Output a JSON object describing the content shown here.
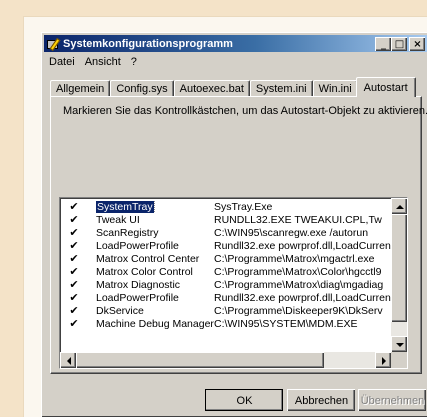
{
  "window": {
    "title": "Systemkonfigurationsprogramm",
    "buttons": {
      "minimize": "_",
      "maximize": "□",
      "close": "×"
    }
  },
  "menu": [
    {
      "label": "Datei"
    },
    {
      "label": "Ansicht"
    },
    {
      "label": "?"
    }
  ],
  "tabs": [
    {
      "label": "Allgemein"
    },
    {
      "label": "Config.sys"
    },
    {
      "label": "Autoexec.bat"
    },
    {
      "label": "System.ini"
    },
    {
      "label": "Win.ini"
    },
    {
      "label": "Autostart",
      "active": true
    }
  ],
  "panel": {
    "instruction": "Markieren Sie das Kontrollkästchen, um das Autostart-Objekt zu aktivieren."
  },
  "startup_items": [
    {
      "checked": true,
      "name": "SystemTray",
      "command": "SysTray.Exe",
      "selected": true
    },
    {
      "checked": true,
      "name": "Tweak UI",
      "command": "RUNDLL32.EXE TWEAKUI.CPL,Tw"
    },
    {
      "checked": true,
      "name": "ScanRegistry",
      "command": "C:\\WIN95\\scanregw.exe /autorun"
    },
    {
      "checked": true,
      "name": "LoadPowerProfile",
      "command": "Rundll32.exe powrprof.dll,LoadCurren"
    },
    {
      "checked": true,
      "name": "Matrox Control Center",
      "command": "C:\\Programme\\Matrox\\mgactrl.exe"
    },
    {
      "checked": true,
      "name": "Matrox Color Control",
      "command": "C:\\Programme\\Matrox\\Color\\hgcctl9"
    },
    {
      "checked": true,
      "name": "Matrox Diagnostic",
      "command": "C:\\Programme\\Matrox\\diag\\mgadiag"
    },
    {
      "checked": true,
      "name": "LoadPowerProfile",
      "command": "Rundll32.exe powrprof.dll,LoadCurren"
    },
    {
      "checked": true,
      "name": "DkService",
      "command": "C:\\Programme\\Diskeeper9K\\DkServ"
    },
    {
      "checked": true,
      "name": "Machine Debug Manager",
      "command": "C:\\WIN95\\SYSTEM\\MDM.EXE"
    }
  ],
  "check_glyph": "✔",
  "footer": {
    "ok": "OK",
    "cancel": "Abbrechen",
    "apply": "Übernehmen"
  }
}
